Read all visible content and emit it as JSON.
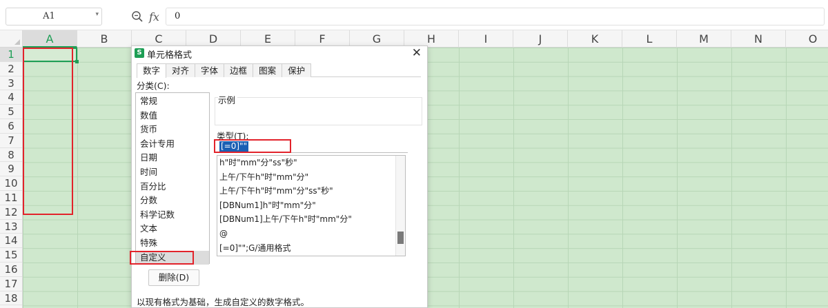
{
  "formula_bar": {
    "name_box": "A1",
    "fx_label": "fx",
    "formula_value": "0"
  },
  "grid": {
    "columns": [
      "A",
      "B",
      "C",
      "D",
      "E",
      "F",
      "G",
      "H",
      "I",
      "J",
      "K",
      "L",
      "M",
      "N",
      "O"
    ],
    "rows": [
      "1",
      "2",
      "3",
      "4",
      "5",
      "6",
      "7",
      "8",
      "9",
      "10",
      "11",
      "12",
      "13",
      "14",
      "15",
      "16",
      "17",
      "18"
    ],
    "active_column": "A",
    "active_row": "1"
  },
  "dialog": {
    "title": "单元格格式",
    "tabs": [
      {
        "label": "数字",
        "active": true
      },
      {
        "label": "对齐",
        "active": false
      },
      {
        "label": "字体",
        "active": false
      },
      {
        "label": "边框",
        "active": false
      },
      {
        "label": "图案",
        "active": false
      },
      {
        "label": "保护",
        "active": false
      }
    ],
    "category_label": "分类(C):",
    "categories": [
      "常规",
      "数值",
      "货币",
      "会计专用",
      "日期",
      "时间",
      "百分比",
      "分数",
      "科学记数",
      "文本",
      "特殊",
      "自定义"
    ],
    "selected_category": "自定义",
    "sample_label": "示例",
    "type_label": "类型(T):",
    "type_value": "[=0]\"\"",
    "format_list": [
      "h\"时\"mm\"分\"ss\"秒\"",
      "上午/下午h\"时\"mm\"分\"",
      "上午/下午h\"时\"mm\"分\"ss\"秒\"",
      "[DBNum1]h\"时\"mm\"分\"",
      "[DBNum1]上午/下午h\"时\"mm\"分\"",
      "@",
      "[=0]\"\";G/通用格式"
    ],
    "delete_button": "删除(D)",
    "hint": "以现有格式为基础，生成自定义的数字格式。"
  },
  "colors": {
    "accent": "#1e9e55",
    "cell_fill": "#cfe8cd",
    "annotation_red": "#e2222a",
    "selection_blue": "#1a5fb4"
  }
}
